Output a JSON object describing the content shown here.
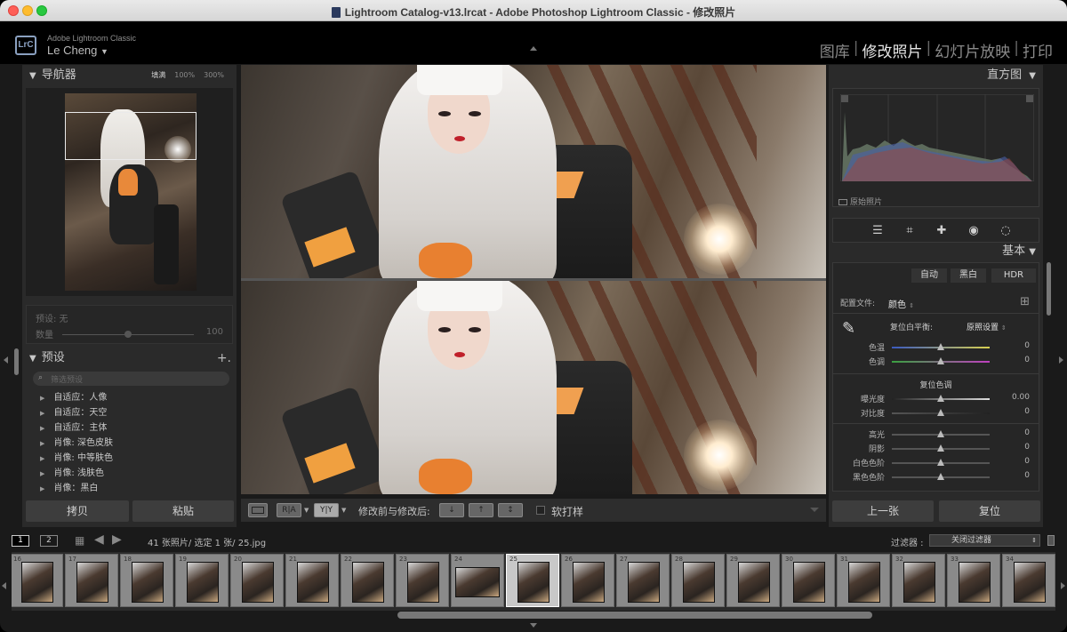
{
  "window": {
    "title": "Lightroom Catalog-v13.lrcat - Adobe Photoshop Lightroom Classic - 修改照片"
  },
  "identity": {
    "logo": "LrC",
    "app_name": "Adobe Lightroom Classic",
    "user": "Le Cheng",
    "user_chevron": "▼"
  },
  "modules": [
    {
      "label": "图库",
      "active": false
    },
    {
      "label": "修改照片",
      "active": true
    },
    {
      "label": "幻灯片放映",
      "active": false
    },
    {
      "label": "打印",
      "active": false
    }
  ],
  "module_separator": "|",
  "navigator": {
    "title": "导航器",
    "fill": "填满",
    "zoom1": "100%",
    "zoom2": "300%"
  },
  "preset_amount": {
    "label": "预设: 无",
    "amount_label": "数量",
    "amount_value": "100"
  },
  "presets": {
    "title": "预设",
    "add": "+.",
    "search_placeholder": "筛选预设",
    "items": [
      "自适应：人像",
      "自适应：天空",
      "自适应：主体",
      "肖像: 深色皮肤",
      "肖像: 中等肤色",
      "肖像: 浅肤色",
      "肖像：黑白"
    ]
  },
  "left_buttons": {
    "copy": "拷贝",
    "paste": "粘贴"
  },
  "toolbar": {
    "before_after_label": "修改前与修改后:",
    "softproof_label": "软打样",
    "yy_label": "Y|Y",
    "ra_label": "R|A"
  },
  "histogram": {
    "title": "直方图",
    "original_label": "原始照片"
  },
  "basic": {
    "title": "基本",
    "treatment": {
      "auto": "自动",
      "bw": "黑白",
      "hdr": "HDR"
    },
    "profile_label": "配置文件:",
    "profile_value": "颜色",
    "wb_label": "复位白平衡:",
    "wb_value": "原照设置",
    "tone_label": "复位色调",
    "sliders_wb": [
      {
        "name": "色温",
        "value": "0"
      },
      {
        "name": "色调",
        "value": "0"
      }
    ],
    "sliders_tone": [
      {
        "name": "曝光度",
        "value": "0.00"
      },
      {
        "name": "对比度",
        "value": "0"
      }
    ],
    "sliders_tone2": [
      {
        "name": "高光",
        "value": "0"
      },
      {
        "name": "阴影",
        "value": "0"
      },
      {
        "name": "白色色阶",
        "value": "0"
      },
      {
        "name": "黑色色阶",
        "value": "0"
      }
    ]
  },
  "right_buttons": {
    "prev": "上一张",
    "reset": "复位"
  },
  "filmstrip_bar": {
    "view1": "1",
    "view2": "2",
    "info": "41 张照片/ 选定 1 张/ 25.jpg",
    "filter_label": "过滤器 :",
    "filter_value": "关闭过滤器"
  },
  "filmstrip": {
    "numbers": [
      "16",
      "17",
      "18",
      "19",
      "20",
      "21",
      "22",
      "23",
      "24",
      "25",
      "26",
      "27",
      "28",
      "29",
      "30",
      "31",
      "32",
      "33",
      "34"
    ],
    "selected": "25"
  }
}
